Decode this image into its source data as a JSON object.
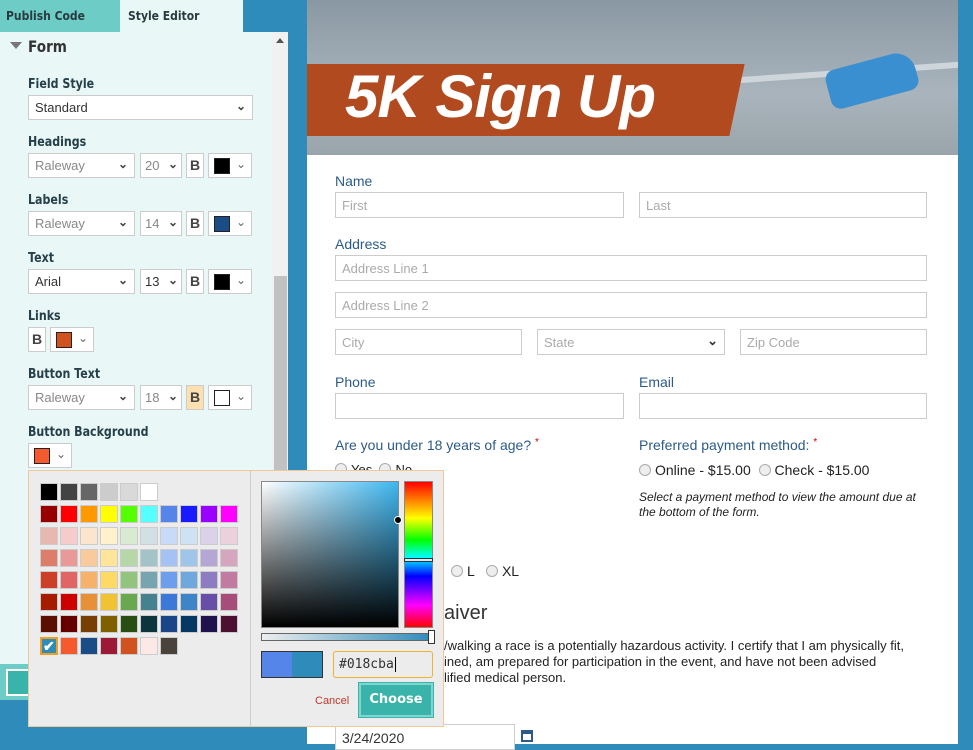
{
  "tabs": [
    {
      "label": "Publish Code",
      "active": false
    },
    {
      "label": "Style Editor",
      "active": true
    }
  ],
  "panel": {
    "section": "Form",
    "field_style": {
      "label": "Field Style",
      "value": "Standard"
    },
    "headings": {
      "label": "Headings",
      "font": "Raleway",
      "size": "20",
      "color": "#000000"
    },
    "labels": {
      "label": "Labels",
      "font": "Raleway",
      "size": "14",
      "color": "#1a4d85"
    },
    "text": {
      "label": "Text",
      "font": "Arial",
      "size": "13",
      "color": "#000000"
    },
    "links": {
      "label": "Links",
      "color": "#d0531f"
    },
    "button_text": {
      "label": "Button Text",
      "font": "Raleway",
      "size": "18",
      "color": "#ffffff",
      "bold_active": true
    },
    "button_background": {
      "label": "Button Background",
      "color": "#f55a2e"
    },
    "bold": "B"
  },
  "picker": {
    "swatches": [
      [
        "#000000",
        "#434343",
        "#666666",
        "#cccccc",
        "#d9d9d9",
        "#ffffff"
      ],
      [
        "#980000",
        "#ff0000",
        "#ff9900",
        "#ffff00",
        "#55ff00",
        "#55ffff",
        "#5585e8",
        "#1a1aff",
        "#9900ff",
        "#ff00ff"
      ],
      [
        "#e6b8af",
        "#f4cccc",
        "#fce5cd",
        "#fff2cc",
        "#d9ead3",
        "#d0e0e3",
        "#c9daf8",
        "#cfe2f3",
        "#d9d2e9",
        "#ead1dc"
      ],
      [
        "#dd7e6b",
        "#ea9999",
        "#f9cb9c",
        "#ffe599",
        "#b6d7a8",
        "#a2c4c9",
        "#a4c2f4",
        "#9fc5e8",
        "#b4a7d6",
        "#d5a6bd"
      ],
      [
        "#cc4125",
        "#e06666",
        "#f6b26b",
        "#ffd966",
        "#93c47d",
        "#76a5af",
        "#6d9eeb",
        "#6fa8dc",
        "#8e7cc3",
        "#c27ba0"
      ],
      [
        "#a61c00",
        "#cc0000",
        "#e69138",
        "#f1c232",
        "#6aa84f",
        "#45818e",
        "#3c78d8",
        "#3d85c6",
        "#674ea7",
        "#a64d79"
      ],
      [
        "#5b0f00",
        "#660000",
        "#783f04",
        "#7f6000",
        "#274e13",
        "#0c343d",
        "#1c4587",
        "#073763",
        "#20124d",
        "#4c1130"
      ],
      [
        "#2e8bba",
        "#f55a2e",
        "#1a4d85",
        "#9b1a35",
        "#d0531f",
        "#fde8e8",
        "#4a433b"
      ]
    ],
    "hex_value": "#018cba",
    "previous_color": "#5585e8",
    "current_color": "#2e8bba",
    "cancel": "Cancel",
    "choose": "Choose"
  },
  "form": {
    "title": "5K Sign Up",
    "name": {
      "label": "Name",
      "first": "First",
      "last": "Last"
    },
    "address": {
      "label": "Address",
      "line1": "Address Line 1",
      "line2": "Address Line 2",
      "city": "City",
      "state": "State",
      "zip": "Zip Code"
    },
    "phone": "Phone",
    "email": "Email",
    "age": {
      "label": "Are you under 18 years of age?",
      "required": "*",
      "yes": "Yes",
      "no": "No"
    },
    "payment": {
      "label": "Preferred payment method:",
      "required": "*",
      "online": "Online - $15.00",
      "check": "Check - $15.00",
      "note": "Select a payment method to view the amount due at the bottom of the form."
    },
    "sizes": {
      "l": "L",
      "xl": "XL"
    },
    "waiver_heading": "aiver",
    "waiver_lines": [
      "/walking a race is a potentially hazardous activity. I certify that I am physically fit,",
      "ined, am prepared for participation in the event, and have not been advised",
      "lified medical person."
    ],
    "date": "3/24/2020"
  }
}
